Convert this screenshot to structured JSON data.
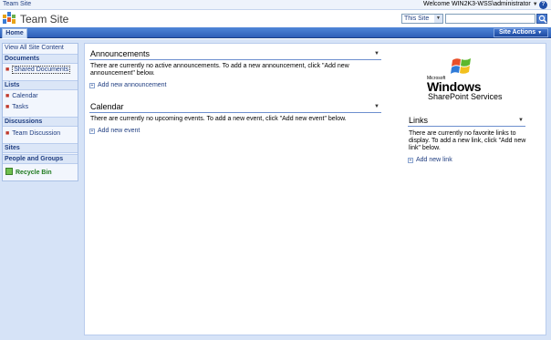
{
  "topbar": {
    "site_crumb": "Team Site",
    "welcome": "Welcome WIN2K3-WSS\\administrator"
  },
  "header": {
    "site_title": "Team Site",
    "search_scope": "This Site"
  },
  "navbar": {
    "home_tab": "Home",
    "site_actions": "Site Actions"
  },
  "quicklaunch": {
    "view_all": "View All Site Content",
    "sections": [
      {
        "title": "Documents",
        "items": [
          "Shared Documents"
        ]
      },
      {
        "title": "Lists",
        "items": [
          "Calendar",
          "Tasks"
        ]
      },
      {
        "title": "Discussions",
        "items": [
          "Team Discussion"
        ]
      },
      {
        "title": "Sites",
        "items": []
      },
      {
        "title": "People and Groups",
        "items": []
      }
    ],
    "recycle_bin": "Recycle Bin"
  },
  "webparts": {
    "announcements": {
      "title": "Announcements",
      "empty_text": "There are currently no active announcements. To add a new announcement, click \"Add new announcement\" below.",
      "add_link": "Add new announcement"
    },
    "calendar": {
      "title": "Calendar",
      "empty_text": "There are currently no upcoming events. To add a new event, click \"Add new event\" below.",
      "add_link": "Add new event"
    },
    "links": {
      "title": "Links",
      "empty_text": "There are currently no favorite links to display. To add a new link, click \"Add new link\" below.",
      "add_link": "Add new link"
    }
  },
  "brand": {
    "microsoft": "Microsoft",
    "windows": "Windows",
    "product": "SharePoint Services"
  },
  "colors": {
    "nav_blue": "#2e5fb8",
    "link_blue": "#1f3d80",
    "page_bg": "#d6e3f7"
  }
}
